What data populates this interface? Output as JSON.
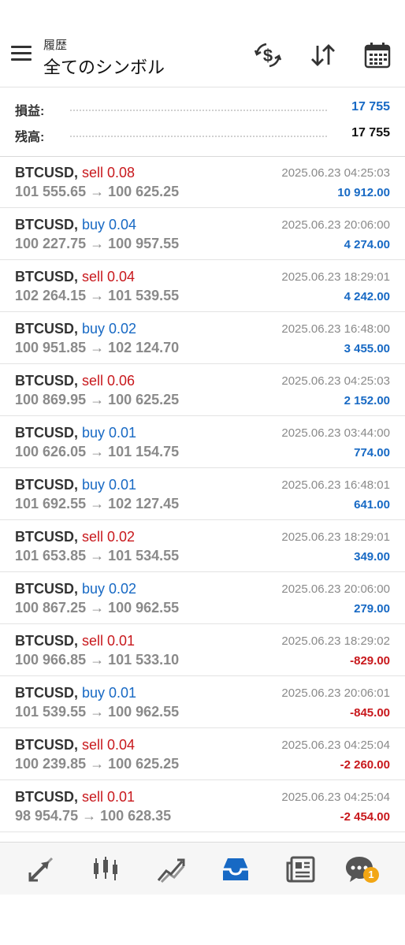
{
  "header": {
    "subtitle": "履歴",
    "title": "全てのシンボル",
    "icons": [
      "menu-icon",
      "currency-exchange-icon",
      "sort-icon",
      "calendar-icon"
    ]
  },
  "summary": {
    "profit_label": "損益:",
    "profit_value": "17 755",
    "profit_color": "#1769c4",
    "balance_label": "残高:",
    "balance_value": "17 755"
  },
  "trades": [
    {
      "symbol": "BTCUSD,",
      "direction": "sell 0.08",
      "type": "sell",
      "time": "2025.06.23 04:25:03",
      "prices": "101 555.65 → 100 625.25",
      "profit": "10 912.00",
      "sign": "pos"
    },
    {
      "symbol": "BTCUSD,",
      "direction": "buy 0.04",
      "type": "buy",
      "time": "2025.06.23 20:06:00",
      "prices": "100 227.75 → 100 957.55",
      "profit": "4 274.00",
      "sign": "pos"
    },
    {
      "symbol": "BTCUSD,",
      "direction": "sell 0.04",
      "type": "sell",
      "time": "2025.06.23 18:29:01",
      "prices": "102 264.15 → 101 539.55",
      "profit": "4 242.00",
      "sign": "pos"
    },
    {
      "symbol": "BTCUSD,",
      "direction": "buy 0.02",
      "type": "buy",
      "time": "2025.06.23 16:48:00",
      "prices": "100 951.85 → 102 124.70",
      "profit": "3 455.00",
      "sign": "pos"
    },
    {
      "symbol": "BTCUSD,",
      "direction": "sell 0.06",
      "type": "sell",
      "time": "2025.06.23 04:25:03",
      "prices": "100 869.95 → 100 625.25",
      "profit": "2 152.00",
      "sign": "pos"
    },
    {
      "symbol": "BTCUSD,",
      "direction": "buy 0.01",
      "type": "buy",
      "time": "2025.06.23 03:44:00",
      "prices": "100 626.05 → 101 154.75",
      "profit": "774.00",
      "sign": "pos"
    },
    {
      "symbol": "BTCUSD,",
      "direction": "buy 0.01",
      "type": "buy",
      "time": "2025.06.23 16:48:01",
      "prices": "101 692.55 → 102 127.45",
      "profit": "641.00",
      "sign": "pos"
    },
    {
      "symbol": "BTCUSD,",
      "direction": "sell 0.02",
      "type": "sell",
      "time": "2025.06.23 18:29:01",
      "prices": "101 653.85 → 101 534.55",
      "profit": "349.00",
      "sign": "pos"
    },
    {
      "symbol": "BTCUSD,",
      "direction": "buy 0.02",
      "type": "buy",
      "time": "2025.06.23 20:06:00",
      "prices": "100 867.25 → 100 962.55",
      "profit": "279.00",
      "sign": "pos"
    },
    {
      "symbol": "BTCUSD,",
      "direction": "sell 0.01",
      "type": "sell",
      "time": "2025.06.23 18:29:02",
      "prices": "100 966.85 → 101 533.10",
      "profit": "-829.00",
      "sign": "neg"
    },
    {
      "symbol": "BTCUSD,",
      "direction": "buy 0.01",
      "type": "buy",
      "time": "2025.06.23 20:06:01",
      "prices": "101 539.55 → 100 962.55",
      "profit": "-845.00",
      "sign": "neg"
    },
    {
      "symbol": "BTCUSD,",
      "direction": "sell 0.04",
      "type": "sell",
      "time": "2025.06.23 04:25:04",
      "prices": "100 239.85 → 100 625.25",
      "profit": "-2 260.00",
      "sign": "neg"
    },
    {
      "symbol": "BTCUSD,",
      "direction": "sell 0.01",
      "type": "sell",
      "time": "2025.06.23 04:25:04",
      "prices": "98 954.75 → 100 628.35",
      "profit": "-2 454.00",
      "sign": "neg"
    }
  ],
  "bottom_nav": {
    "items": [
      "trade-icon",
      "chart-icon",
      "trend-icon",
      "history-icon",
      "news-icon",
      "chat-icon"
    ],
    "active": "history-icon",
    "active_color": "#1769c4",
    "chat_badge": "1"
  }
}
